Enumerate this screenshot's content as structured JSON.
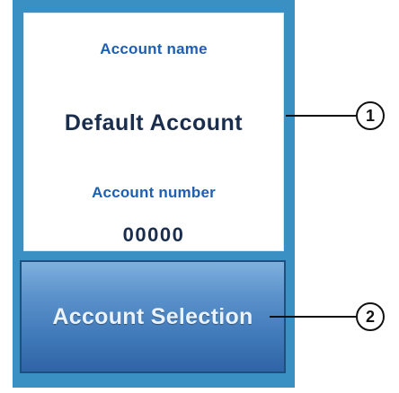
{
  "account_panel": {
    "account_name_label": "Account name",
    "account_name_value": "Default Account",
    "account_number_label": "Account number",
    "account_number_value": "00000"
  },
  "account_selection_button": {
    "label": "Account Selection"
  },
  "callouts": [
    {
      "number": "1"
    },
    {
      "number": "2"
    }
  ],
  "colors": {
    "frame": "#3a8fc3",
    "label_text": "#1d5fb0",
    "value_text": "#1a2d4d",
    "button_gradient_top": "#7fb0de",
    "button_gradient_bottom": "#2f64a5"
  }
}
